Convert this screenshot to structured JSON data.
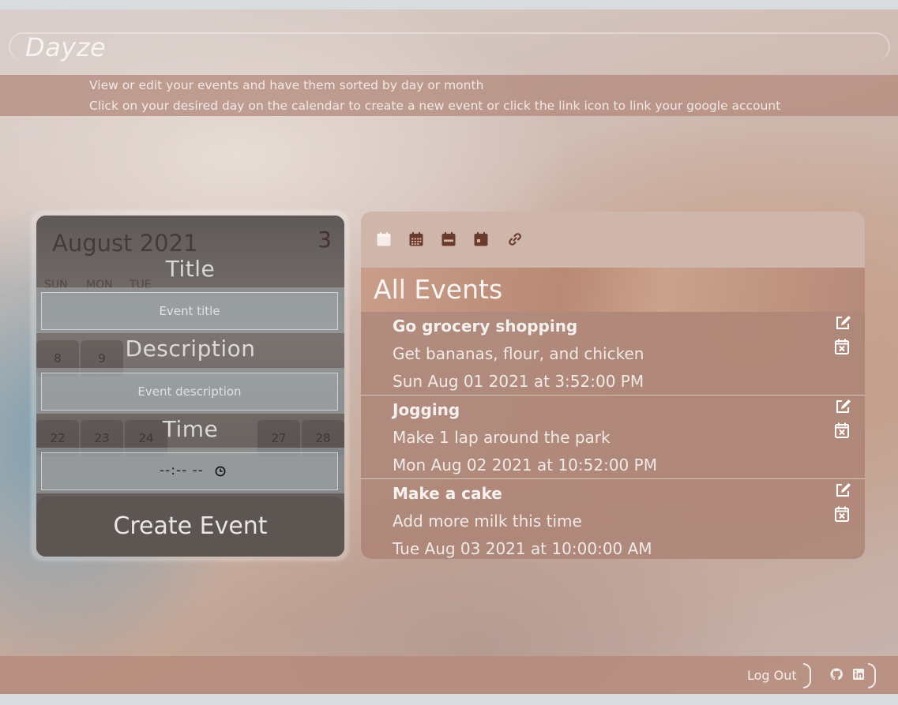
{
  "app": {
    "brand": "Dayze",
    "info_lines": [
      "View or edit your events and have them sorted by day or month",
      "Click on your desired day on the calendar to create a new event or click the link icon to link your google account"
    ]
  },
  "calendar": {
    "month_label": "August 2021",
    "selected_day": "3",
    "weekdays": [
      "SUN",
      "MON",
      "TUE"
    ],
    "visible_days_row1": [
      "8",
      "9"
    ],
    "visible_days_row2": [
      "22",
      "23",
      "24",
      "27",
      "28"
    ]
  },
  "form": {
    "title_label": "Title",
    "title_placeholder": "Event title",
    "description_label": "Description",
    "description_placeholder": "Event description",
    "time_label": "Time",
    "time_value": "--:-- --",
    "create_button": "Create Event"
  },
  "toolbar": {
    "icons": [
      "calendar-blank-icon",
      "calendar-month-icon",
      "calendar-week-icon",
      "calendar-day-icon",
      "link-icon"
    ]
  },
  "events_panel": {
    "title": "All Events",
    "events": [
      {
        "title": "Go grocery shopping",
        "description": "Get bananas, flour, and chicken",
        "time": "Sun Aug 01 2021 at 3:52:00 PM"
      },
      {
        "title": "Jogging",
        "description": "Make 1 lap around the park",
        "time": "Mon Aug 02 2021 at 10:52:00 PM"
      },
      {
        "title": "Make a cake",
        "description": "Add more milk this time",
        "time": "Tue Aug 03 2021 at 10:00:00 AM"
      }
    ]
  },
  "footer": {
    "logout": "Log Out",
    "icons": [
      "github-icon",
      "linkedin-icon"
    ]
  }
}
